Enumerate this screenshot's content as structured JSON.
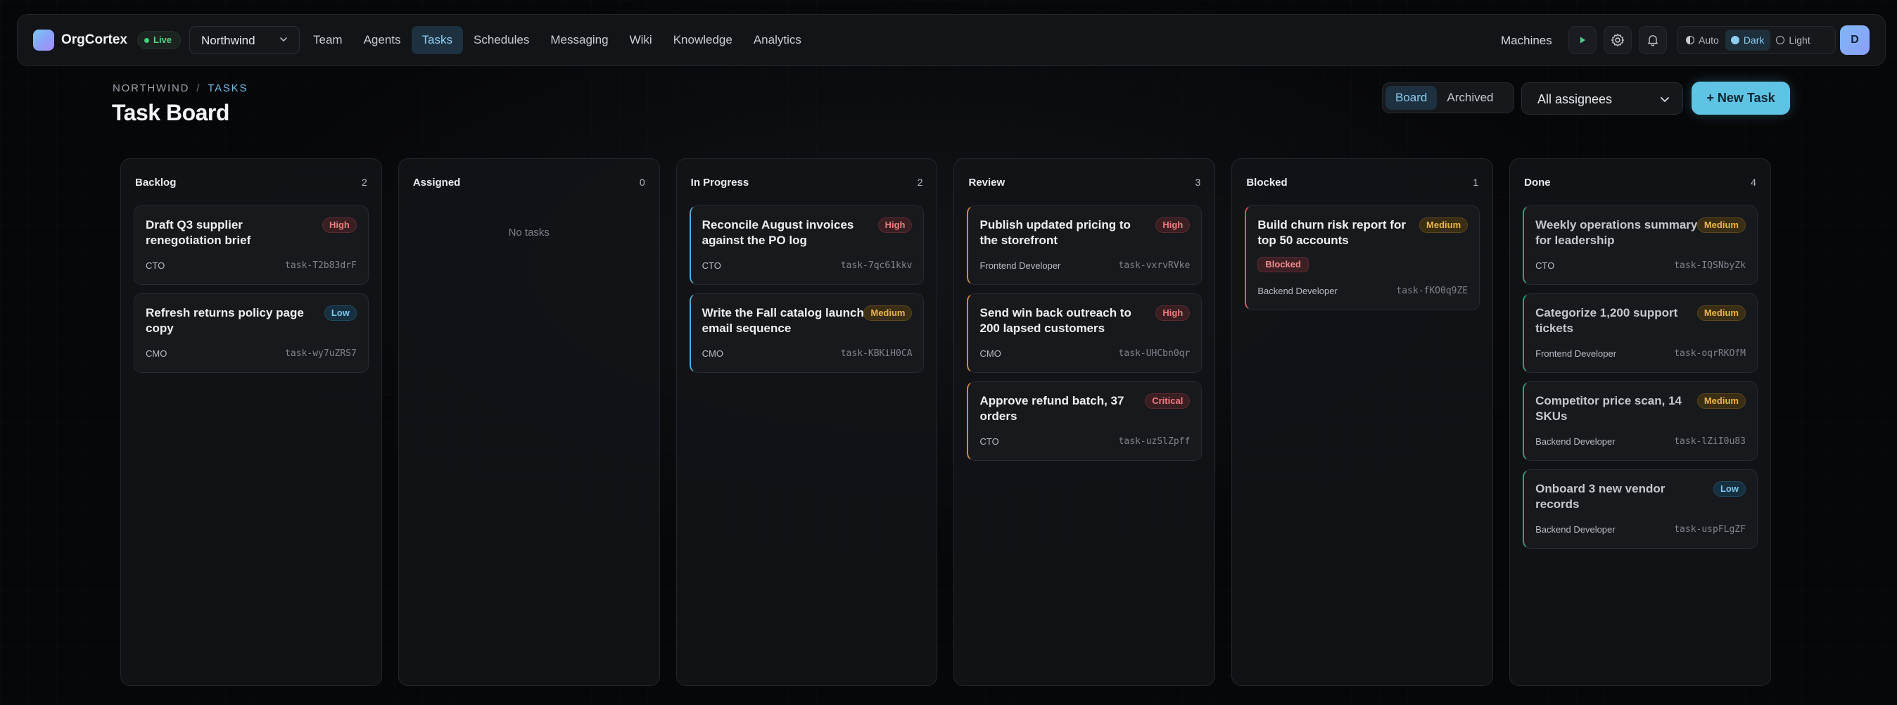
{
  "navbar": {
    "brand": "OrgCortex",
    "live_label": "Live",
    "workspace": "Northwind",
    "links": [
      {
        "label": "Team"
      },
      {
        "label": "Agents"
      },
      {
        "label": "Tasks",
        "active": true
      },
      {
        "label": "Schedules"
      },
      {
        "label": "Messaging"
      },
      {
        "label": "Wiki"
      },
      {
        "label": "Knowledge"
      },
      {
        "label": "Analytics"
      }
    ],
    "machines_label": "Machines",
    "theme": {
      "auto": "Auto",
      "dark": "Dark",
      "light": "Light",
      "selected": "Dark"
    },
    "avatar_initial": "D"
  },
  "header": {
    "breadcrumb_root": "NORTHWIND",
    "breadcrumb_sep": "/",
    "breadcrumb_current": "TASKS",
    "title": "Task Board",
    "view_board": "Board",
    "view_archived": "Archived",
    "assignee_filter": "All assignees",
    "new_task_label": "+ New Task"
  },
  "colors": {
    "accent": "#5fc3e4",
    "in_progress": "#4faed6",
    "review": "#c9913a",
    "blocked": "#d85c5c",
    "done": "#3e9c74"
  },
  "columns": [
    {
      "title": "Backlog",
      "count": "2",
      "cards": [
        {
          "title": "Draft Q3 supplier renegotiation brief",
          "priority": "High",
          "assignee": "CTO",
          "id": "task-T2b83drF"
        },
        {
          "title": "Refresh returns policy page copy",
          "priority": "Low",
          "assignee": "CMO",
          "id": "task-wy7uZRS7"
        }
      ]
    },
    {
      "title": "Assigned",
      "count": "0",
      "empty": "No tasks",
      "cards": []
    },
    {
      "title": "In Progress",
      "count": "2",
      "cards": [
        {
          "title": "Reconcile August invoices against the PO log",
          "priority": "High",
          "assignee": "CTO",
          "id": "task-7qc61kkv"
        },
        {
          "title": "Write the Fall catalog launch email sequence",
          "priority": "Medium",
          "assignee": "CMO",
          "id": "task-KBKiH0CA"
        }
      ]
    },
    {
      "title": "Review",
      "count": "3",
      "cards": [
        {
          "title": "Publish updated pricing to the storefront",
          "priority": "High",
          "assignee": "Frontend Developer",
          "id": "task-vxrvRVke"
        },
        {
          "title": "Send win back outreach to 200 lapsed customers",
          "priority": "High",
          "assignee": "CMO",
          "id": "task-UHCbn0qr"
        },
        {
          "title": "Approve refund batch, 37 orders",
          "priority": "Critical",
          "assignee": "CTO",
          "id": "task-uzSlZpff"
        }
      ]
    },
    {
      "title": "Blocked",
      "count": "1",
      "cards": [
        {
          "title": "Build churn risk report for top 50 accounts",
          "priority": "Medium",
          "status_tag": "Blocked",
          "assignee": "Backend Developer",
          "id": "task-fKO0q9ZE"
        }
      ]
    },
    {
      "title": "Done",
      "count": "4",
      "cards": [
        {
          "title": "Weekly operations summary for leadership",
          "priority": "Medium",
          "assignee": "CTO",
          "id": "task-IQSNbyZk"
        },
        {
          "title": "Categorize 1,200 support tickets",
          "priority": "Medium",
          "assignee": "Frontend Developer",
          "id": "task-oqrRKOfM"
        },
        {
          "title": "Competitor price scan, 14 SKUs",
          "priority": "Medium",
          "assignee": "Backend Developer",
          "id": "task-lZiI0u83"
        },
        {
          "title": "Onboard 3 new vendor records",
          "priority": "Low",
          "assignee": "Backend Developer",
          "id": "task-uspFLgZF"
        }
      ]
    }
  ]
}
